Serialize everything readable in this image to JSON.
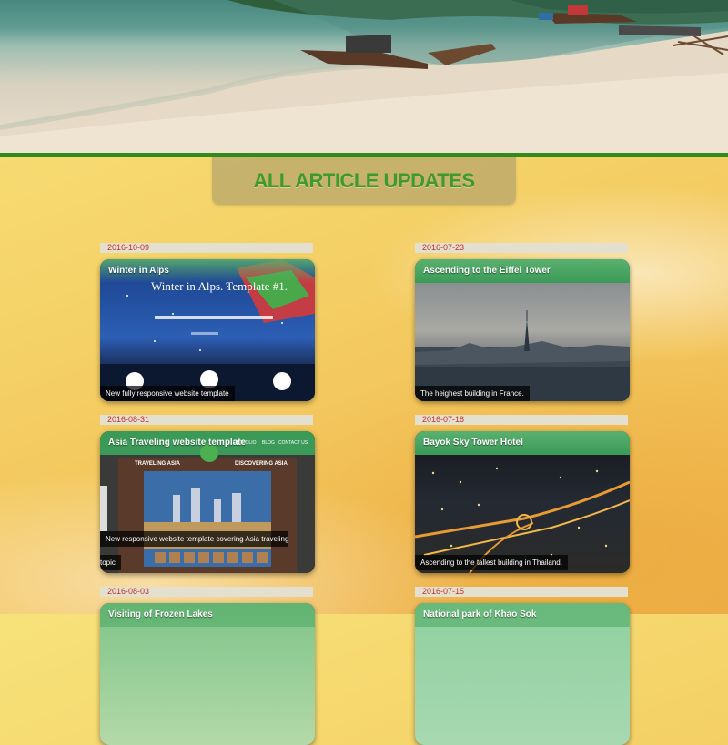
{
  "page": {
    "section_title": "ALL ARTICLE UPDATES"
  },
  "articles": [
    {
      "date": "2016-10-09",
      "title": "Winter in Alps",
      "caption": "New fully responsive website template",
      "image": "winter-alps-template-screenshot",
      "image_text": "Winter in Alps. Template #1."
    },
    {
      "date": "2016-07-23",
      "title": "Ascending to the Eiffel Tower",
      "caption": "The heighest building in France.",
      "image": "paris-skyline-photo"
    },
    {
      "date": "2016-08-31",
      "title": "Asia Traveling website template",
      "caption": "New responsive website template covering Asia traveling",
      "caption2": "topic",
      "image": "asia-template-screenshot",
      "image_labels": [
        "TRAVELING ASIA",
        "DISCOVERING ASIA",
        "ORTFOLIO",
        "BLOG",
        "CONTACT US"
      ]
    },
    {
      "date": "2016-07-18",
      "title": "Bayok Sky Tower Hotel",
      "caption": "Ascending to the tallest building in Thailand.",
      "image": "bangkok-night-photo"
    },
    {
      "date": "2016-08-03",
      "title": "Visiting of Frozen Lakes",
      "image": "frozen-lakes-photo"
    },
    {
      "date": "2016-07-15",
      "title": "National park of Khao Sok",
      "image": "khao-sok-photo"
    }
  ],
  "colors": {
    "accent_green": "#2e8b1c",
    "date_red": "#c0302a",
    "title_green": "#3e9a2a"
  }
}
